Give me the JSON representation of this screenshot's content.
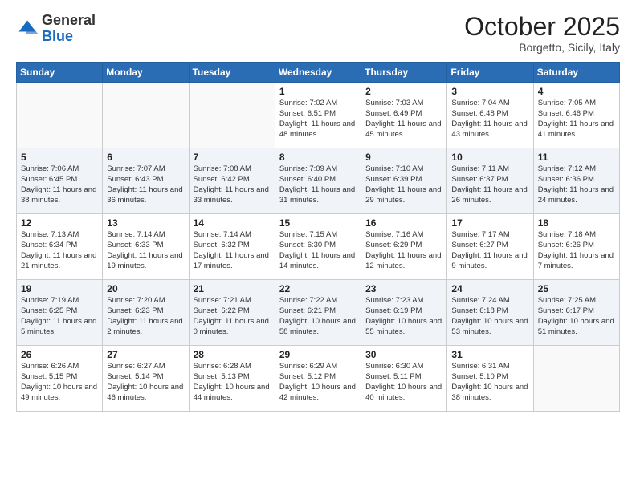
{
  "header": {
    "logo_general": "General",
    "logo_blue": "Blue",
    "month_title": "October 2025",
    "location": "Borgetto, Sicily, Italy"
  },
  "columns": [
    "Sunday",
    "Monday",
    "Tuesday",
    "Wednesday",
    "Thursday",
    "Friday",
    "Saturday"
  ],
  "weeks": [
    [
      {
        "day": "",
        "info": ""
      },
      {
        "day": "",
        "info": ""
      },
      {
        "day": "",
        "info": ""
      },
      {
        "day": "1",
        "info": "Sunrise: 7:02 AM\nSunset: 6:51 PM\nDaylight: 11 hours and 48 minutes."
      },
      {
        "day": "2",
        "info": "Sunrise: 7:03 AM\nSunset: 6:49 PM\nDaylight: 11 hours and 45 minutes."
      },
      {
        "day": "3",
        "info": "Sunrise: 7:04 AM\nSunset: 6:48 PM\nDaylight: 11 hours and 43 minutes."
      },
      {
        "day": "4",
        "info": "Sunrise: 7:05 AM\nSunset: 6:46 PM\nDaylight: 11 hours and 41 minutes."
      }
    ],
    [
      {
        "day": "5",
        "info": "Sunrise: 7:06 AM\nSunset: 6:45 PM\nDaylight: 11 hours and 38 minutes."
      },
      {
        "day": "6",
        "info": "Sunrise: 7:07 AM\nSunset: 6:43 PM\nDaylight: 11 hours and 36 minutes."
      },
      {
        "day": "7",
        "info": "Sunrise: 7:08 AM\nSunset: 6:42 PM\nDaylight: 11 hours and 33 minutes."
      },
      {
        "day": "8",
        "info": "Sunrise: 7:09 AM\nSunset: 6:40 PM\nDaylight: 11 hours and 31 minutes."
      },
      {
        "day": "9",
        "info": "Sunrise: 7:10 AM\nSunset: 6:39 PM\nDaylight: 11 hours and 29 minutes."
      },
      {
        "day": "10",
        "info": "Sunrise: 7:11 AM\nSunset: 6:37 PM\nDaylight: 11 hours and 26 minutes."
      },
      {
        "day": "11",
        "info": "Sunrise: 7:12 AM\nSunset: 6:36 PM\nDaylight: 11 hours and 24 minutes."
      }
    ],
    [
      {
        "day": "12",
        "info": "Sunrise: 7:13 AM\nSunset: 6:34 PM\nDaylight: 11 hours and 21 minutes."
      },
      {
        "day": "13",
        "info": "Sunrise: 7:14 AM\nSunset: 6:33 PM\nDaylight: 11 hours and 19 minutes."
      },
      {
        "day": "14",
        "info": "Sunrise: 7:14 AM\nSunset: 6:32 PM\nDaylight: 11 hours and 17 minutes."
      },
      {
        "day": "15",
        "info": "Sunrise: 7:15 AM\nSunset: 6:30 PM\nDaylight: 11 hours and 14 minutes."
      },
      {
        "day": "16",
        "info": "Sunrise: 7:16 AM\nSunset: 6:29 PM\nDaylight: 11 hours and 12 minutes."
      },
      {
        "day": "17",
        "info": "Sunrise: 7:17 AM\nSunset: 6:27 PM\nDaylight: 11 hours and 9 minutes."
      },
      {
        "day": "18",
        "info": "Sunrise: 7:18 AM\nSunset: 6:26 PM\nDaylight: 11 hours and 7 minutes."
      }
    ],
    [
      {
        "day": "19",
        "info": "Sunrise: 7:19 AM\nSunset: 6:25 PM\nDaylight: 11 hours and 5 minutes."
      },
      {
        "day": "20",
        "info": "Sunrise: 7:20 AM\nSunset: 6:23 PM\nDaylight: 11 hours and 2 minutes."
      },
      {
        "day": "21",
        "info": "Sunrise: 7:21 AM\nSunset: 6:22 PM\nDaylight: 11 hours and 0 minutes."
      },
      {
        "day": "22",
        "info": "Sunrise: 7:22 AM\nSunset: 6:21 PM\nDaylight: 10 hours and 58 minutes."
      },
      {
        "day": "23",
        "info": "Sunrise: 7:23 AM\nSunset: 6:19 PM\nDaylight: 10 hours and 55 minutes."
      },
      {
        "day": "24",
        "info": "Sunrise: 7:24 AM\nSunset: 6:18 PM\nDaylight: 10 hours and 53 minutes."
      },
      {
        "day": "25",
        "info": "Sunrise: 7:25 AM\nSunset: 6:17 PM\nDaylight: 10 hours and 51 minutes."
      }
    ],
    [
      {
        "day": "26",
        "info": "Sunrise: 6:26 AM\nSunset: 5:15 PM\nDaylight: 10 hours and 49 minutes."
      },
      {
        "day": "27",
        "info": "Sunrise: 6:27 AM\nSunset: 5:14 PM\nDaylight: 10 hours and 46 minutes."
      },
      {
        "day": "28",
        "info": "Sunrise: 6:28 AM\nSunset: 5:13 PM\nDaylight: 10 hours and 44 minutes."
      },
      {
        "day": "29",
        "info": "Sunrise: 6:29 AM\nSunset: 5:12 PM\nDaylight: 10 hours and 42 minutes."
      },
      {
        "day": "30",
        "info": "Sunrise: 6:30 AM\nSunset: 5:11 PM\nDaylight: 10 hours and 40 minutes."
      },
      {
        "day": "31",
        "info": "Sunrise: 6:31 AM\nSunset: 5:10 PM\nDaylight: 10 hours and 38 minutes."
      },
      {
        "day": "",
        "info": ""
      }
    ]
  ]
}
